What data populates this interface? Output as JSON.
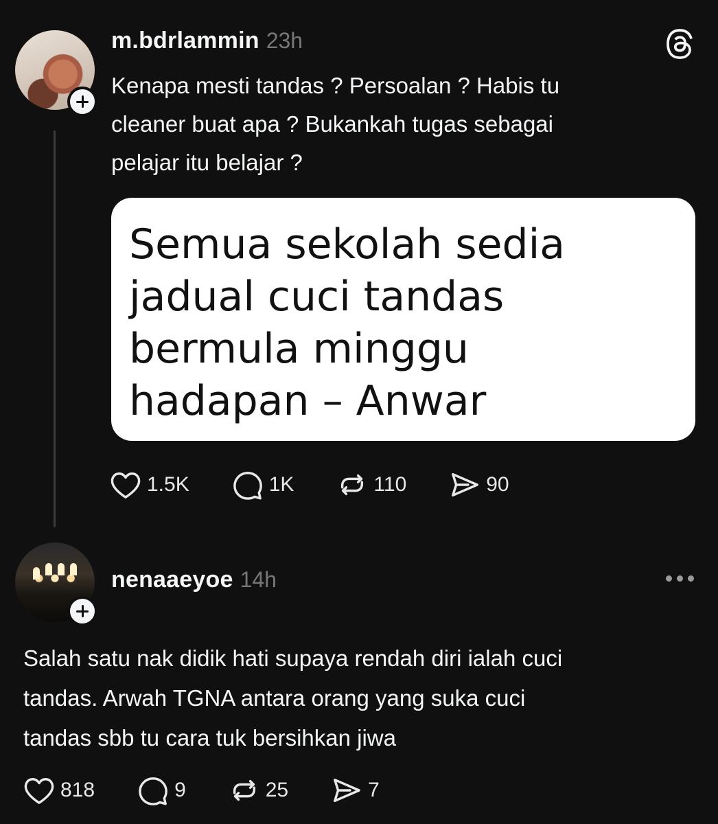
{
  "post": {
    "username": "m.bdrlammin",
    "time": "23h",
    "text_lines": [
      "Kenapa mesti tandas ? Persoalan ? Habis tu",
      "cleaner buat apa ? Bukankah tugas sebagai",
      "pelajar itu belajar ?"
    ],
    "quote_image_lines": [
      "Semua sekolah sedia",
      "jadual cuci tandas",
      "bermula minggu",
      "hadapan – Anwar"
    ],
    "likes": "1.5K",
    "replies": "1K",
    "reposts": "110",
    "shares": "90"
  },
  "reply": {
    "username": "nenaaeyoe",
    "time": "14h",
    "text_lines": [
      "Salah satu nak didik hati supaya rendah diri ialah cuci",
      "tandas. Arwah TGNA antara orang yang suka cuci",
      "tandas sbb tu cara tuk bersihkan jiwa"
    ],
    "likes": "818",
    "replies": "9",
    "reposts": "25",
    "shares": "7"
  },
  "icons": {
    "app_logo": "threads-logo-icon",
    "like": "heart-icon",
    "reply": "comment-icon",
    "repost": "repost-icon",
    "share": "send-icon",
    "more": "more-icon",
    "follow": "plus-icon"
  }
}
